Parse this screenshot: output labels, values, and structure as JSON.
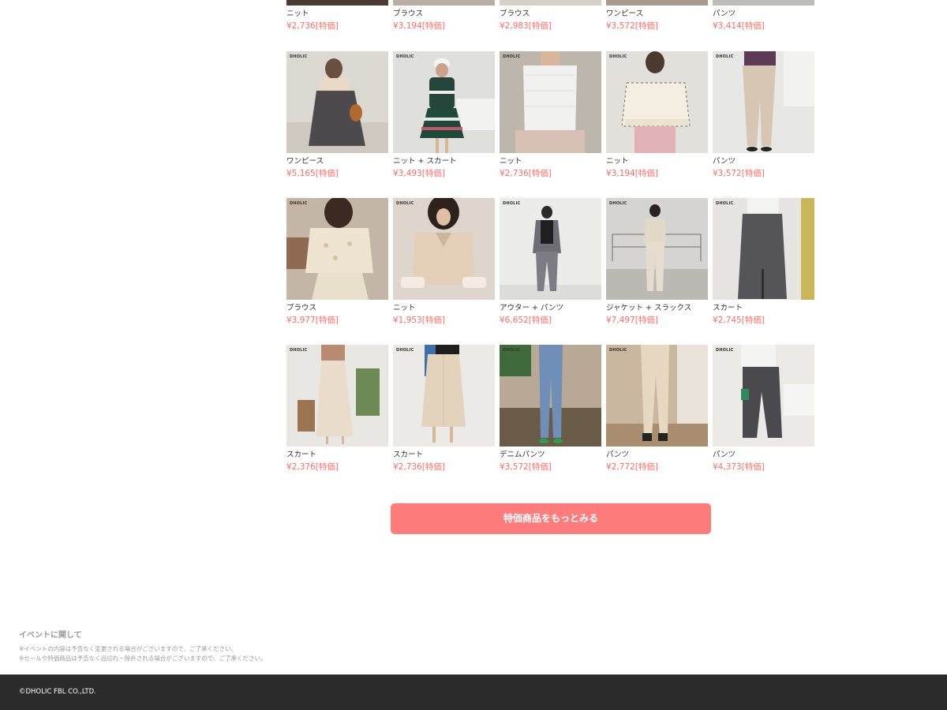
{
  "colors": {
    "price": "#ff6b66",
    "button_bg": "#ff7c7c",
    "footer_bg": "#2b2b2b"
  },
  "brand_mark": "DHOLIC",
  "top_row": [
    {
      "category": "ニット",
      "price": "¥2,736[特価]"
    },
    {
      "category": "ブラウス",
      "price": "¥3,194[特価]"
    },
    {
      "category": "ブラウス",
      "price": "¥2,983[特価]"
    },
    {
      "category": "ワンピース",
      "price": "¥3,572[特価]"
    },
    {
      "category": "パンツ",
      "price": "¥3,414[特価]"
    }
  ],
  "rows": [
    [
      {
        "category": "ワンピース",
        "price": "¥5,165[特価]"
      },
      {
        "category": "ニット + スカート",
        "price": "¥3,493[特価]"
      },
      {
        "category": "ニット",
        "price": "¥2,736[特価]"
      },
      {
        "category": "ニット",
        "price": "¥3,194[特価]"
      },
      {
        "category": "パンツ",
        "price": "¥3,572[特価]"
      }
    ],
    [
      {
        "category": "ブラウス",
        "price": "¥3,977[特価]"
      },
      {
        "category": "ニット",
        "price": "¥1,953[特価]"
      },
      {
        "category": "アウター + パンツ",
        "price": "¥6,652[特価]"
      },
      {
        "category": "ジャケット + スラックス",
        "price": "¥7,497[特価]"
      },
      {
        "category": "スカート",
        "price": "¥2,745[特価]"
      }
    ],
    [
      {
        "category": "スカート",
        "price": "¥2,376[特価]"
      },
      {
        "category": "スカート",
        "price": "¥2,736[特価]"
      },
      {
        "category": "デニムパンツ",
        "price": "¥3,572[特価]"
      },
      {
        "category": "パンツ",
        "price": "¥2,772[特価]"
      },
      {
        "category": "パンツ",
        "price": "¥4,373[特価]"
      }
    ]
  ],
  "more_button": "特価商品をもっとみる",
  "notice": {
    "title": "イベントに関して",
    "line1": "※イベントの内容は予告なく変更される場合がございますので、ご了承ください。",
    "line2": "※セールや特価商品は予告なく品切れ・除外される場合がございますので、ご了承ください。"
  },
  "footer": {
    "copyright": "©DHOLIC FBL CO.,LTD."
  }
}
